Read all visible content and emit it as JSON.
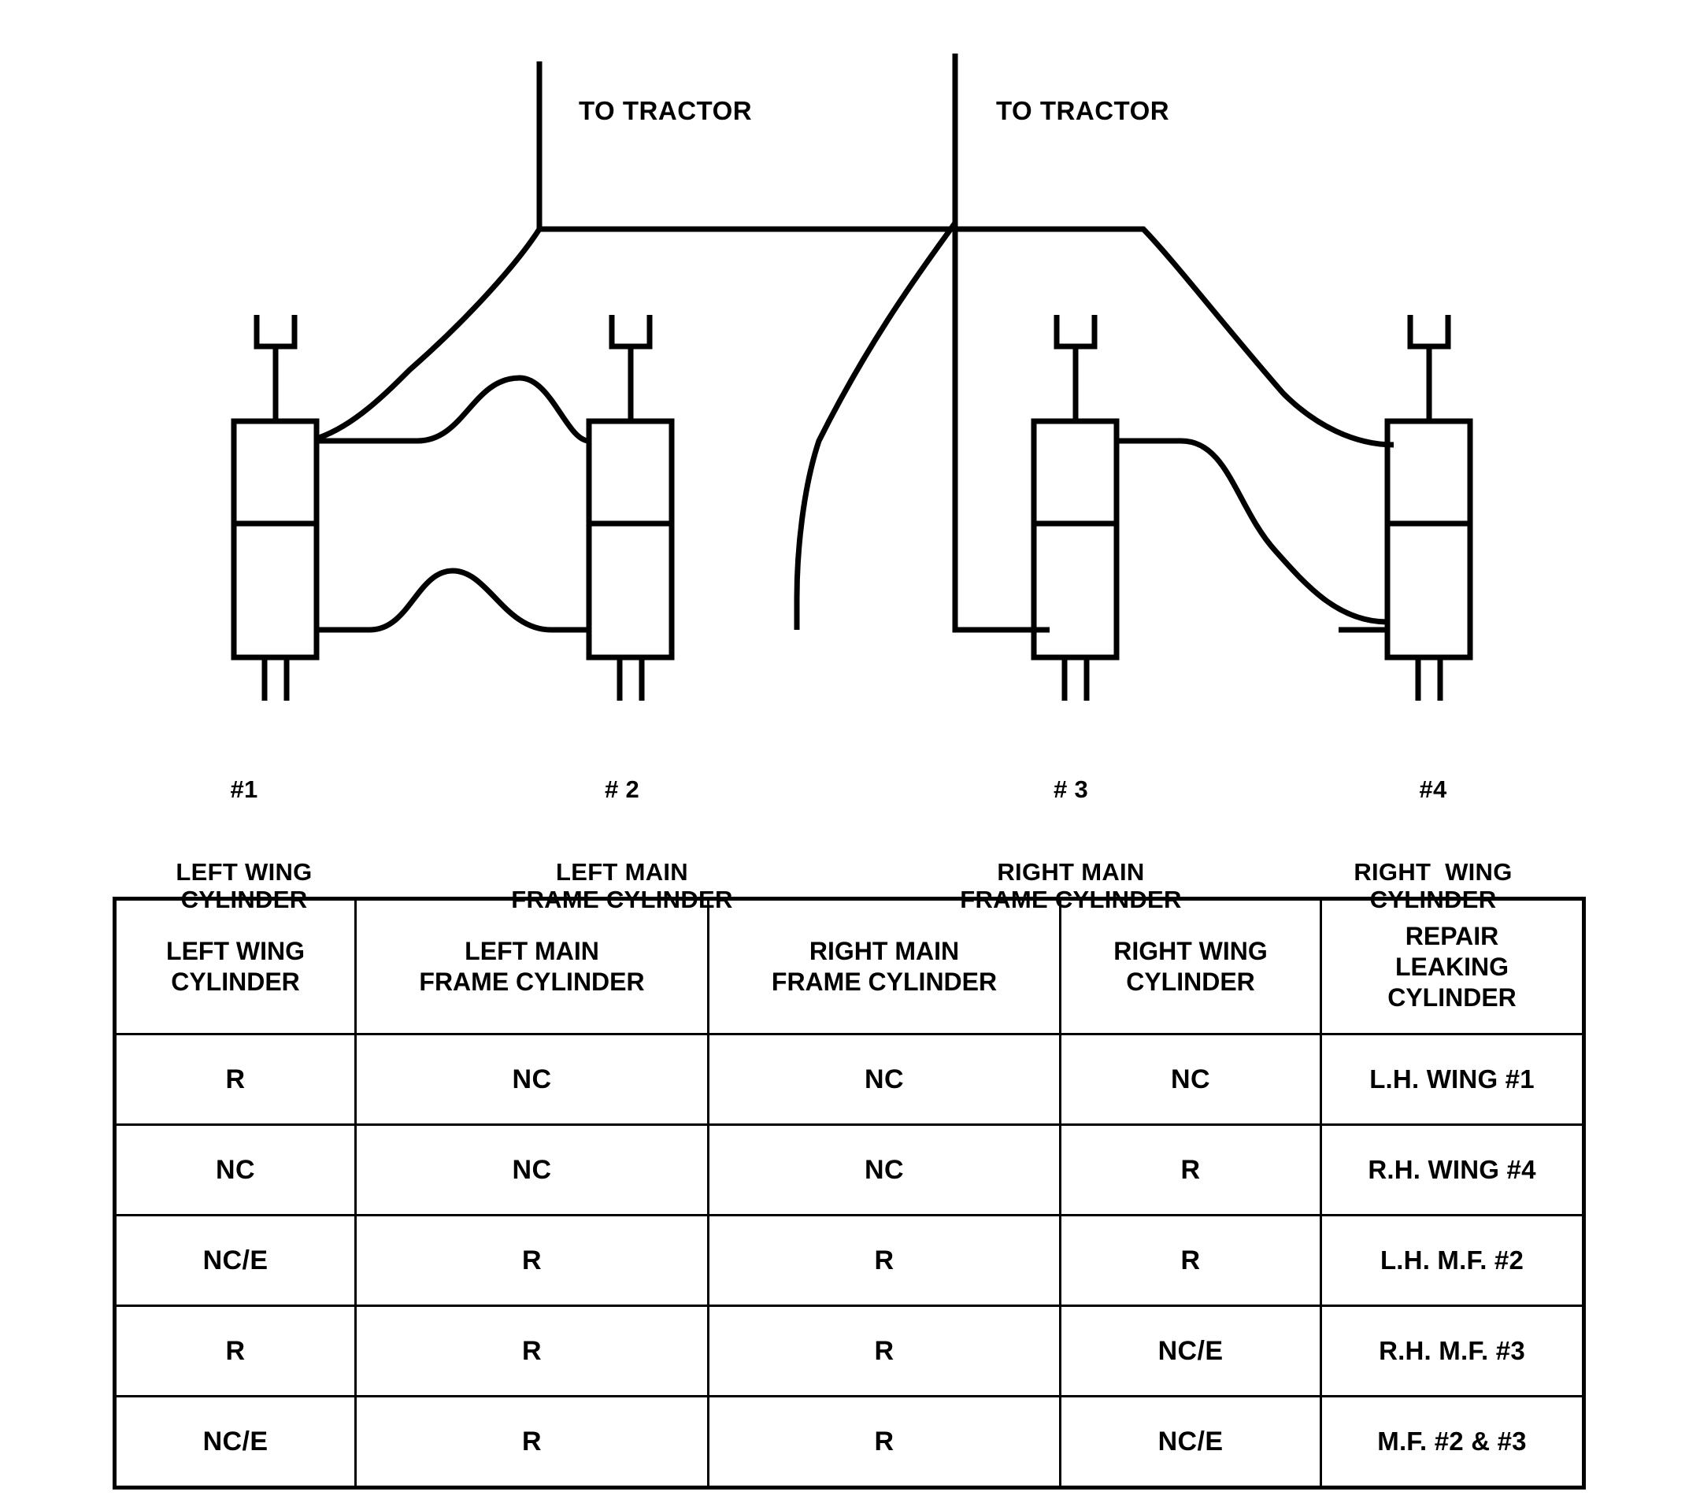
{
  "schematic": {
    "tractor_label_left": "TO TRACTOR",
    "tractor_label_right": "TO TRACTOR",
    "cylinders": [
      {
        "number": "#1",
        "name": "LEFT WING\nCYLINDER"
      },
      {
        "number": "# 2",
        "name": "LEFT MAIN\nFRAME CYLINDER"
      },
      {
        "number": "# 3",
        "name": "RIGHT MAIN\nFRAME CYLINDER"
      },
      {
        "number": "#4",
        "name": "RIGHT  WING\nCYLINDER"
      }
    ]
  },
  "table": {
    "headers": [
      "LEFT WING\nCYLINDER",
      "LEFT MAIN\nFRAME CYLINDER",
      "RIGHT MAIN\nFRAME CYLINDER",
      "RIGHT  WING\nCYLINDER",
      "REPAIR\nLEAKING\nCYLINDER"
    ],
    "rows": [
      [
        "R",
        "NC",
        "NC",
        "NC",
        "L.H. WING #1"
      ],
      [
        "NC",
        "NC",
        "NC",
        "R",
        "R.H. WING #4"
      ],
      [
        "NC/E",
        "R",
        "R",
        "R",
        "L.H. M.F. #2"
      ],
      [
        "R",
        "R",
        "R",
        "NC/E",
        "R.H. M.F. #3"
      ],
      [
        "NC/E",
        "R",
        "R",
        "NC/E",
        "M.F. #2 & #3"
      ]
    ]
  },
  "colors": {
    "ink": "#000000",
    "paper": "#ffffff"
  }
}
